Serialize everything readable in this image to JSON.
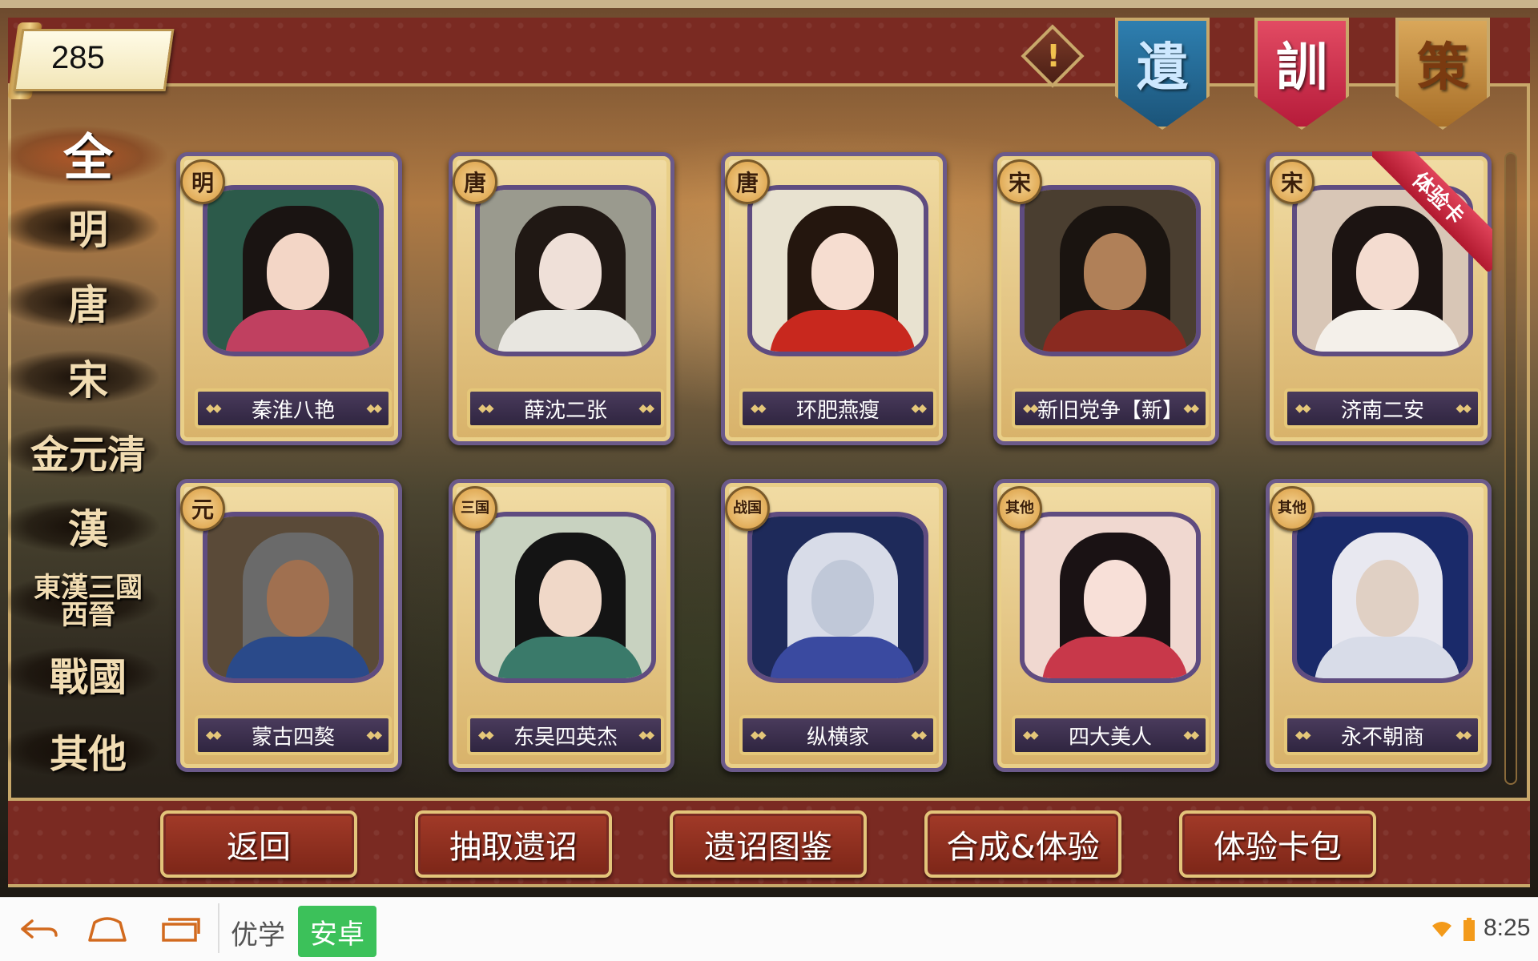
{
  "gold": "285",
  "top_banners": [
    {
      "key": "yi",
      "label": "遺"
    },
    {
      "key": "xun",
      "label": "訓"
    },
    {
      "key": "ce",
      "label": "策"
    }
  ],
  "warning_glyph": "!",
  "categories": [
    "全",
    "明",
    "唐",
    "宋",
    "金元清",
    "漢",
    "東漢三國西晉",
    "戰國",
    "其他"
  ],
  "active_category": "全",
  "cards": [
    {
      "era": "明",
      "name": "秦淮八艳",
      "palette": {
        "bg": "#2c5a4a",
        "hair": "#1a1412",
        "face": "#f3d6c6",
        "robe": "#c04060"
      }
    },
    {
      "era": "唐",
      "name": "薛沈二张",
      "palette": {
        "bg": "#9a9a8e",
        "hair": "#201814",
        "face": "#efe0d8",
        "robe": "#e8e6e0"
      }
    },
    {
      "era": "唐",
      "name": "环肥燕瘦",
      "palette": {
        "bg": "#e8e2d0",
        "hair": "#24160e",
        "face": "#f6ddd0",
        "robe": "#c8281e"
      }
    },
    {
      "era": "宋",
      "name": "新旧党争【新】",
      "palette": {
        "bg": "#4a3e30",
        "hair": "#1a1410",
        "face": "#b08058",
        "robe": "#8a2a20"
      }
    },
    {
      "era": "宋",
      "name": "济南二安",
      "palette": {
        "bg": "#d8c6b6",
        "hair": "#1c1412",
        "face": "#f4dcd0",
        "robe": "#f4f0ea"
      },
      "trial": "体验卡"
    },
    {
      "era": "元",
      "name": "蒙古四獒",
      "palette": {
        "bg": "#5a4a38",
        "hair": "#6a6a6a",
        "face": "#a07050",
        "robe": "#2a4a8a"
      }
    },
    {
      "era": "三国",
      "name": "东吴四英杰",
      "palette": {
        "bg": "#c8d2c0",
        "hair": "#141414",
        "face": "#f0d8c8",
        "robe": "#3a7a6a"
      }
    },
    {
      "era": "战国",
      "name": "纵横家",
      "palette": {
        "bg": "#1e2a5a",
        "hair": "#d8dce8",
        "face": "#c0c8d8",
        "robe": "#3a4aa0"
      }
    },
    {
      "era": "其他",
      "name": "四大美人",
      "palette": {
        "bg": "#f0d8d0",
        "hair": "#1a1214",
        "face": "#f8e0d8",
        "robe": "#c8384a"
      }
    },
    {
      "era": "其他",
      "name": "永不朝商",
      "palette": {
        "bg": "#1a2a6a",
        "hair": "#e8e8f0",
        "face": "#e0d0c4",
        "robe": "#d8dce8"
      }
    }
  ],
  "actions": [
    "返回",
    "抽取遗诏",
    "遗诏图鉴",
    "合成&体验",
    "体验卡包"
  ],
  "system_bar": {
    "app_label": "优学",
    "app_chip": "安卓",
    "time": "8:25"
  }
}
